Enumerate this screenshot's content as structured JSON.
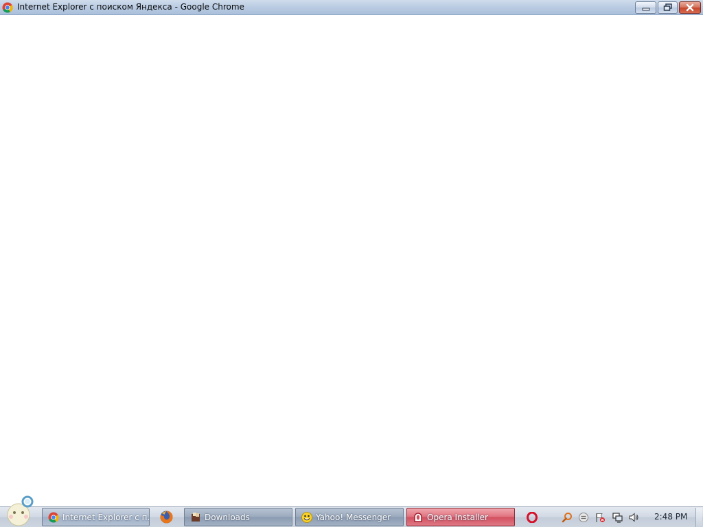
{
  "window": {
    "title": "Internet Explorer с поиском Яндекса - Google Chrome",
    "app_icon": "chrome-icon",
    "buttons": [
      "minimize-icon",
      "restore-icon",
      "close-icon"
    ]
  },
  "taskbar": {
    "start_icon": "windows-start-orb",
    "tasks": [
      {
        "label": "Internet Explorer с п...",
        "icon": "chrome-icon",
        "state": "active"
      },
      {
        "label": "Downloads",
        "icon": "downloads-folder-icon",
        "state": "normal"
      },
      {
        "label": "Yahoo! Messenger",
        "icon": "yahoo-messenger-icon",
        "state": "normal"
      },
      {
        "label": "Opera Installer",
        "icon": "opera-installer-icon",
        "state": "flashing"
      }
    ],
    "quick_launch": [
      "firefox-icon"
    ],
    "tray": {
      "icons": [
        "opera-icon",
        "search-icon",
        "messenger-status-icon",
        "action-center-flag-icon",
        "network-icon",
        "volume-icon"
      ],
      "clock": "2:48 PM"
    }
  },
  "colors": {
    "titlebar": "#bccde3",
    "taskbar": "#d1d9e4",
    "flashing_task": "#d24f5f",
    "close_button": "#c4442b"
  }
}
